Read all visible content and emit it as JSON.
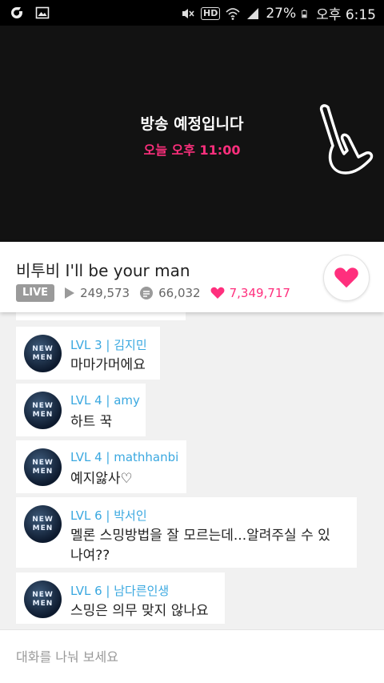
{
  "status_bar": {
    "battery": "27%",
    "time": "오후 6:15",
    "hd": "HD"
  },
  "video": {
    "schedule_title": "방송 예정입니다",
    "schedule_time": "오늘 오후 11:00"
  },
  "info": {
    "title": "비투비 I'll be your man",
    "live_label": "LIVE",
    "plays": "249,573",
    "comments": "66,032",
    "hearts": "7,349,717",
    "accent": "#ff2f7d"
  },
  "chat": {
    "avatar_text": [
      "NEW",
      "MEN"
    ],
    "messages": [
      {
        "level": "LVL 3",
        "name": "김지민",
        "text": "마마가머에요"
      },
      {
        "level": "LVL 4",
        "name": "amy",
        "text": "하트 꾹"
      },
      {
        "level": "LVL 4",
        "name": "mathhanbi",
        "text": "예지앓사♡"
      },
      {
        "level": "LVL 6",
        "name": "박서인",
        "text": "멜론 스밍방법을 잘 모르는데...알려주실 수 있나여??"
      },
      {
        "level": "LVL 6",
        "name": "남다른인생",
        "text": "스밍은 의무 맞지 않나요"
      }
    ]
  },
  "input": {
    "placeholder": "대화를 나눠 보세요"
  }
}
